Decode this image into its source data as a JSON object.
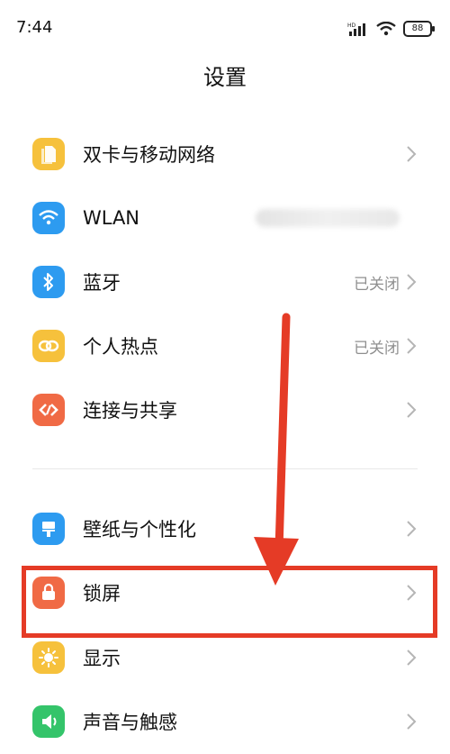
{
  "status_bar": {
    "time": "7:44",
    "battery": "88"
  },
  "header": {
    "title": "设置"
  },
  "items": [
    {
      "label": "双卡与移动网络",
      "value": ""
    },
    {
      "label": "WLAN",
      "value": ""
    },
    {
      "label": "蓝牙",
      "value": "已关闭"
    },
    {
      "label": "个人热点",
      "value": "已关闭"
    },
    {
      "label": "连接与共享",
      "value": ""
    },
    {
      "label": "壁纸与个性化",
      "value": ""
    },
    {
      "label": "锁屏",
      "value": ""
    },
    {
      "label": "显示",
      "value": ""
    },
    {
      "label": "声音与触感",
      "value": ""
    }
  ],
  "colors": {
    "dual_sim": "#f6c13c",
    "wlan": "#2d9bf0",
    "bluetooth": "#2d9bf0",
    "hotspot": "#f6c13c",
    "connect_share": "#f06a45",
    "wallpaper": "#2d9bf0",
    "lock_screen": "#f06a45",
    "display": "#f6c13c",
    "sound": "#34c46a",
    "annotation_red": "#e53b26"
  },
  "icons": [
    "sim-card-icon",
    "wifi-icon",
    "bluetooth-icon",
    "hotspot-icon",
    "connect-share-icon",
    "wallpaper-icon",
    "lock-icon",
    "sun-icon",
    "speaker-icon"
  ]
}
